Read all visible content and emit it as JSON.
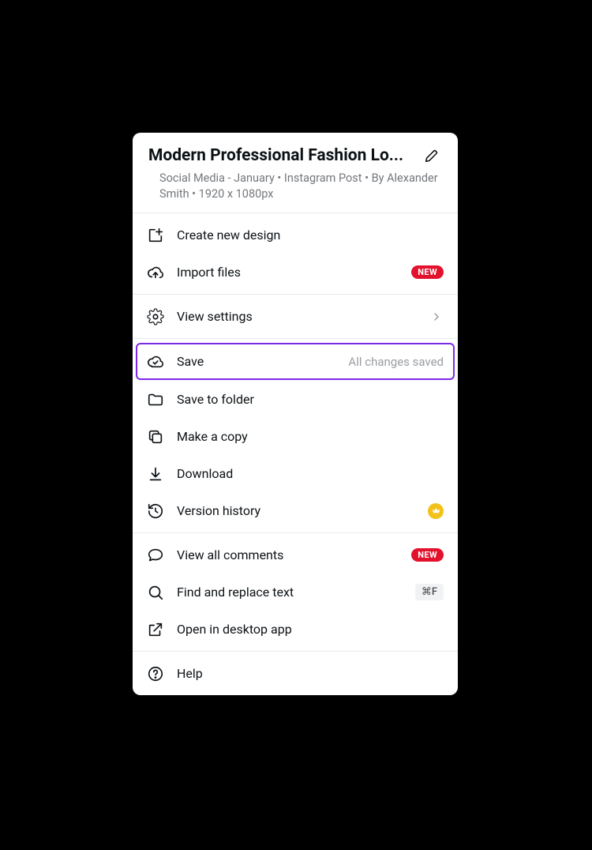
{
  "header": {
    "title": "Modern Professional Fashion Lo...",
    "meta": "Social Media - January  • Instagram Post  • By Alexander Smith • 1920 x 1080px"
  },
  "badges": {
    "new": "NEW",
    "shortcut_find": "⌘F"
  },
  "menu": {
    "create_new": "Create new design",
    "import_files": "Import files",
    "view_settings": "View settings",
    "save": "Save",
    "save_status": "All changes saved",
    "save_to_folder": "Save to folder",
    "make_a_copy": "Make a copy",
    "download": "Download",
    "version_history": "Version history",
    "view_all_comments": "View all comments",
    "find_replace": "Find and replace text",
    "open_desktop": "Open in desktop app",
    "help": "Help"
  }
}
